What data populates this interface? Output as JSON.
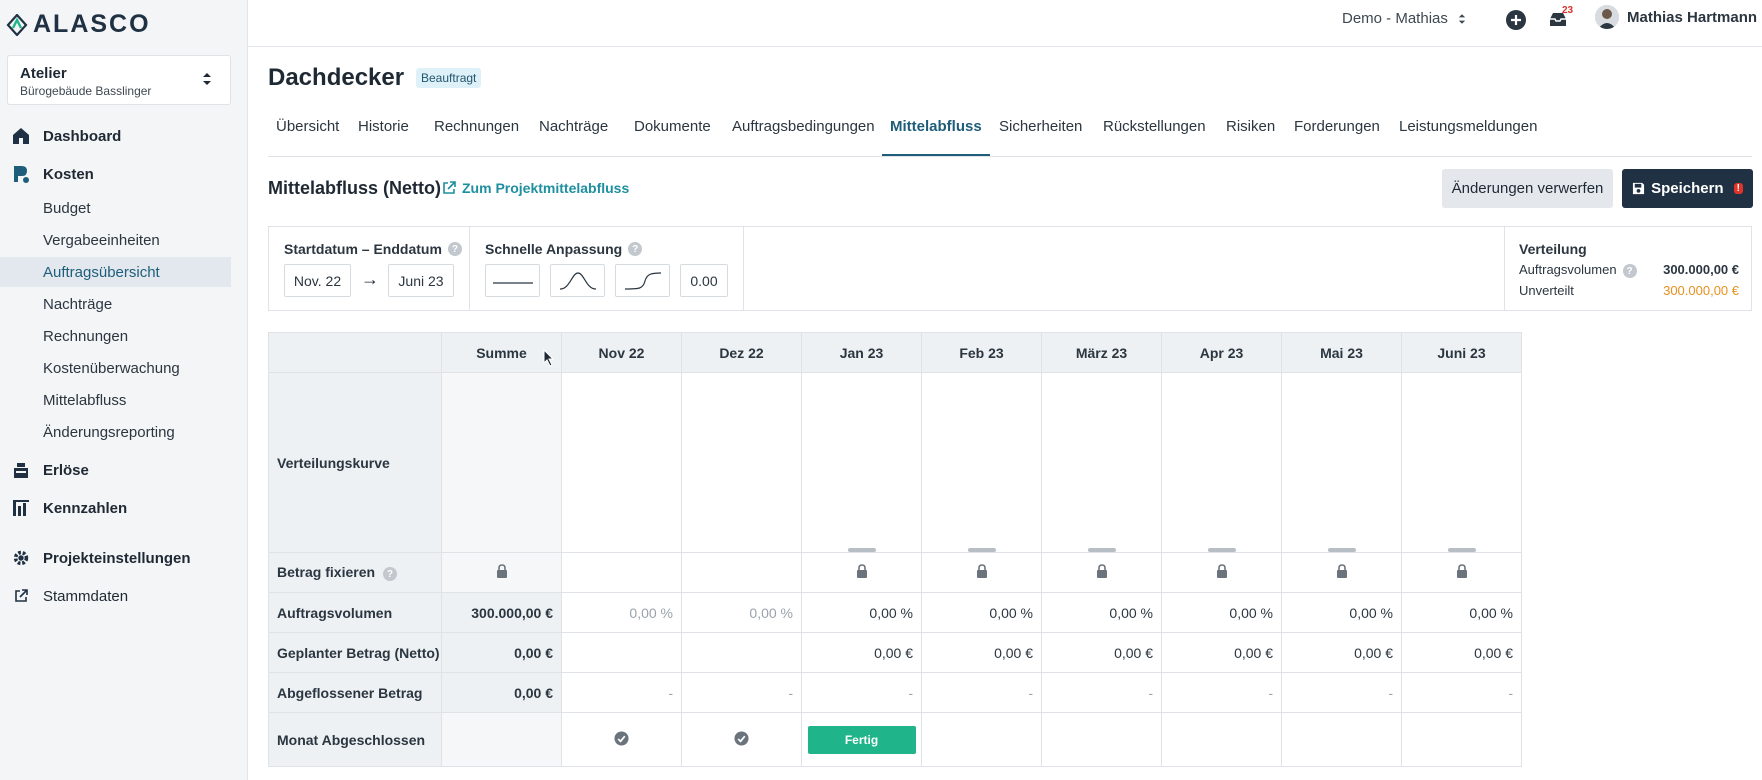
{
  "brand": {
    "name": "ALASCO",
    "color": "#1f3142"
  },
  "project": {
    "name": "Atelier",
    "subtitle": "Bürogebäude Basslinger"
  },
  "sidebar": {
    "dashboard": "Dashboard",
    "kosten": "Kosten",
    "kosten_items": [
      "Budget",
      "Vergabeeinheiten",
      "Auftragsübersicht",
      "Nachträge",
      "Rechnungen",
      "Kostenüberwachung",
      "Mittelabfluss",
      "Änderungsreporting"
    ],
    "active_item": "Auftragsübersicht",
    "erloese": "Erlöse",
    "kennzahlen": "Kennzahlen",
    "projekteinstellungen": "Projekteinstellungen",
    "stammdaten": "Stammdaten"
  },
  "topbar": {
    "workspace": "Demo - Mathias",
    "notification_count": "23",
    "user_name": "Mathias Hartmann"
  },
  "page": {
    "title": "Dachdecker",
    "status": "Beauftragt"
  },
  "tabs": [
    "Übersicht",
    "Historie",
    "Rechnungen",
    "Nachträge",
    "Dokumente",
    "Auftragsbedingungen",
    "Mittelabfluss",
    "Sicherheiten",
    "Rückstellungen",
    "Risiken",
    "Forderungen",
    "Leistungsmeldungen"
  ],
  "active_tab": "Mittelabfluss",
  "section": {
    "title": "Mittelabfluss (Netto)",
    "link": "Zum Projektmittelabfluss",
    "discard_label": "Änderungen verwerfen",
    "save_label": "Speichern",
    "save_warning": "!"
  },
  "settings": {
    "date_label": "Startdatum – Enddatum",
    "start": "Nov. 22",
    "end": "Juni 23",
    "quick_label": "Schnelle Anpassung",
    "quick_value": "0.00",
    "distribution_label": "Verteilung",
    "volume_label": "Auftragsvolumen",
    "volume_value": "300.000,00 €",
    "unassigned_label": "Unverteilt",
    "unassigned_value": "300.000,00 €",
    "unassigned_color": "#e8901e"
  },
  "table": {
    "sum_header": "Summe",
    "months": [
      "Nov 22",
      "Dez 22",
      "Jan 23",
      "Feb 23",
      "März 23",
      "Apr 23",
      "Mai 23",
      "Juni 23"
    ],
    "rows": {
      "curve": "Verteilungskurve",
      "fix": "Betrag fixieren",
      "volume": "Auftragsvolumen",
      "planned": "Geplanter Betrag (Netto)",
      "paid": "Abgeflossener Betrag",
      "closed": "Monat Abgeschlossen"
    },
    "volume_sum": "300.000,00 €",
    "volume_values": [
      "0,00 %",
      "0,00 %",
      "0,00 %",
      "0,00 %",
      "0,00 %",
      "0,00 %",
      "0,00 %",
      "0,00 %"
    ],
    "planned_sum": "0,00 €",
    "planned_values": [
      "",
      "",
      "0,00 €",
      "0,00 €",
      "0,00 €",
      "0,00 €",
      "0,00 €",
      "0,00 €"
    ],
    "paid_sum": "0,00 €",
    "paid_values": [
      "-",
      "-",
      "-",
      "-",
      "-",
      "-",
      "-",
      "-"
    ],
    "done_label": "Fertig"
  }
}
